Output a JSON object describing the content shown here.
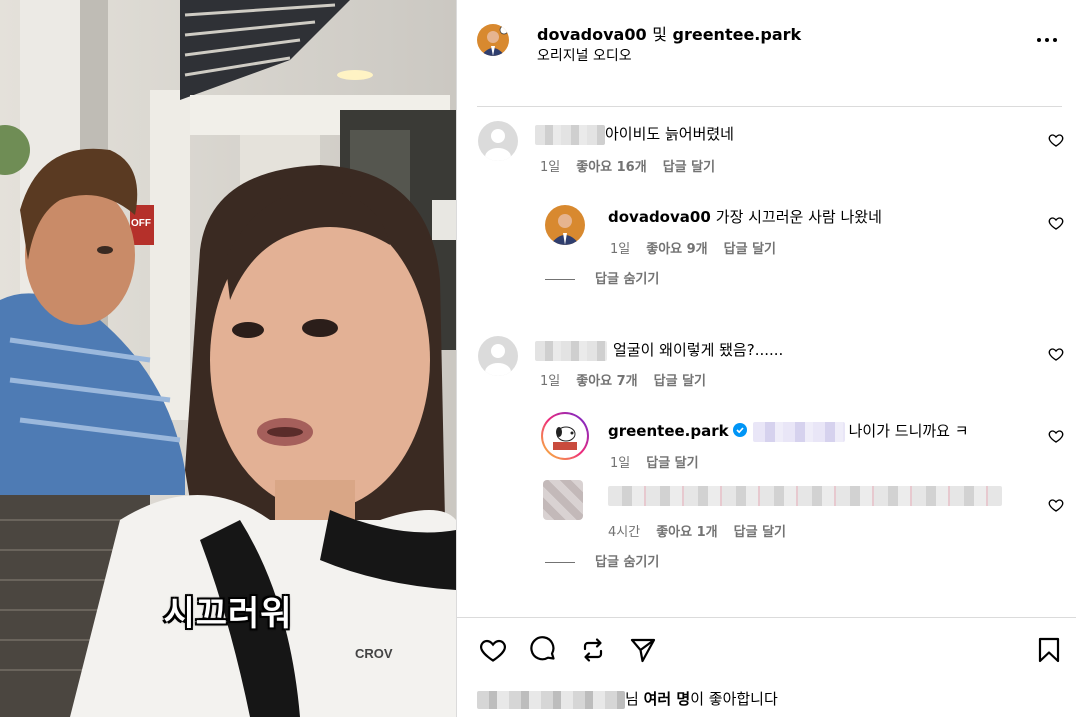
{
  "video": {
    "caption": "시끄러워",
    "shirt_text": "CROV",
    "sign_text": "OFF"
  },
  "header": {
    "user1": "dovadova00",
    "conjunction": "및",
    "user2": "greentee.park",
    "audio": "오리지널 오디오",
    "icons": {
      "avatar": "profile-avatar",
      "more": "more-options-icon"
    }
  },
  "comments": [
    {
      "text": "아이비도 늙어버렸네",
      "time": "1일",
      "likes": "좋아요 16개",
      "reply": "답글 달기"
    },
    {
      "author": "dovadova00",
      "text": "가장 시끄러운 사람 나왔네",
      "time": "1일",
      "likes": "좋아요 9개",
      "reply": "답글 달기"
    },
    {
      "text": "얼굴이 왜이렇게 됐음?......",
      "time": "1일",
      "likes": "좋아요 7개",
      "reply": "답글 달기"
    },
    {
      "author": "greentee.park",
      "text": "나이가 드니까요 ㅋ",
      "time": "1일",
      "reply": "답글 달기"
    },
    {
      "time": "4시간",
      "likes": "좋아요 1개",
      "reply": "답글 달기"
    }
  ],
  "hide_replies": "답글 숨기기",
  "actions": {
    "like": "heart-icon",
    "comment": "comment-icon",
    "share": "repost-icon",
    "send": "send-icon",
    "save": "bookmark-icon"
  },
  "liked_by": {
    "suffix": "님",
    "bold": "여러 명",
    "rest": "이 좋아합니다"
  },
  "colors": {
    "verified": "#0095f6",
    "muted": "#737373",
    "divider": "#dbdbdb"
  }
}
